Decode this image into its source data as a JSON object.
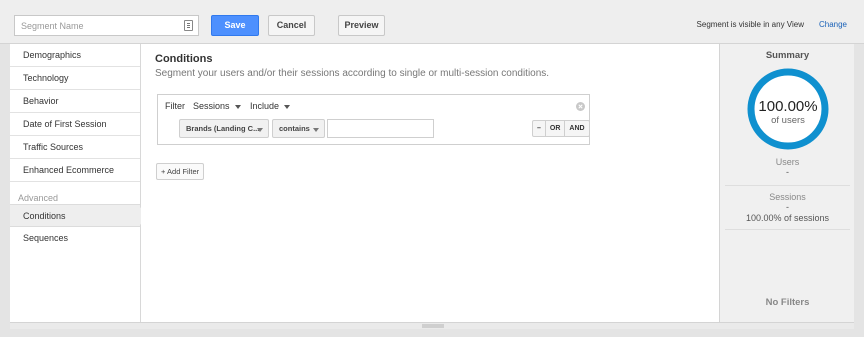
{
  "toolbar": {
    "segment_name_placeholder": "Segment Name",
    "save_label": "Save",
    "cancel_label": "Cancel",
    "preview_label": "Preview",
    "visibility_text": "Segment is visible in any View",
    "change_label": "Change"
  },
  "sidebar": {
    "items": [
      {
        "label": "Demographics"
      },
      {
        "label": "Technology"
      },
      {
        "label": "Behavior"
      },
      {
        "label": "Date of First Session"
      },
      {
        "label": "Traffic Sources"
      },
      {
        "label": "Enhanced Ecommerce"
      }
    ],
    "advanced_heading": "Advanced",
    "advanced_items": [
      {
        "label": "Conditions",
        "active": true
      },
      {
        "label": "Sequences",
        "active": false
      }
    ]
  },
  "main": {
    "title": "Conditions",
    "subtitle": "Segment your users and/or their sessions according to single or multi-session conditions.",
    "filter": {
      "label": "Filter",
      "scope": "Sessions",
      "mode": "Include",
      "dimension": "Brands (Landing C...",
      "operator": "contains",
      "value": "",
      "remove_label": "–",
      "or_label": "OR",
      "and_label": "AND"
    },
    "add_filter_label": "+ Add Filter"
  },
  "summary": {
    "title": "Summary",
    "percent": "100.00%",
    "percent_label": "of users",
    "gauge_color": "#0f90cf",
    "users_label": "Users",
    "users_value": "-",
    "sessions_label": "Sessions",
    "sessions_value": "-",
    "sessions_pct": "100.00% of sessions",
    "no_filters": "No Filters"
  }
}
